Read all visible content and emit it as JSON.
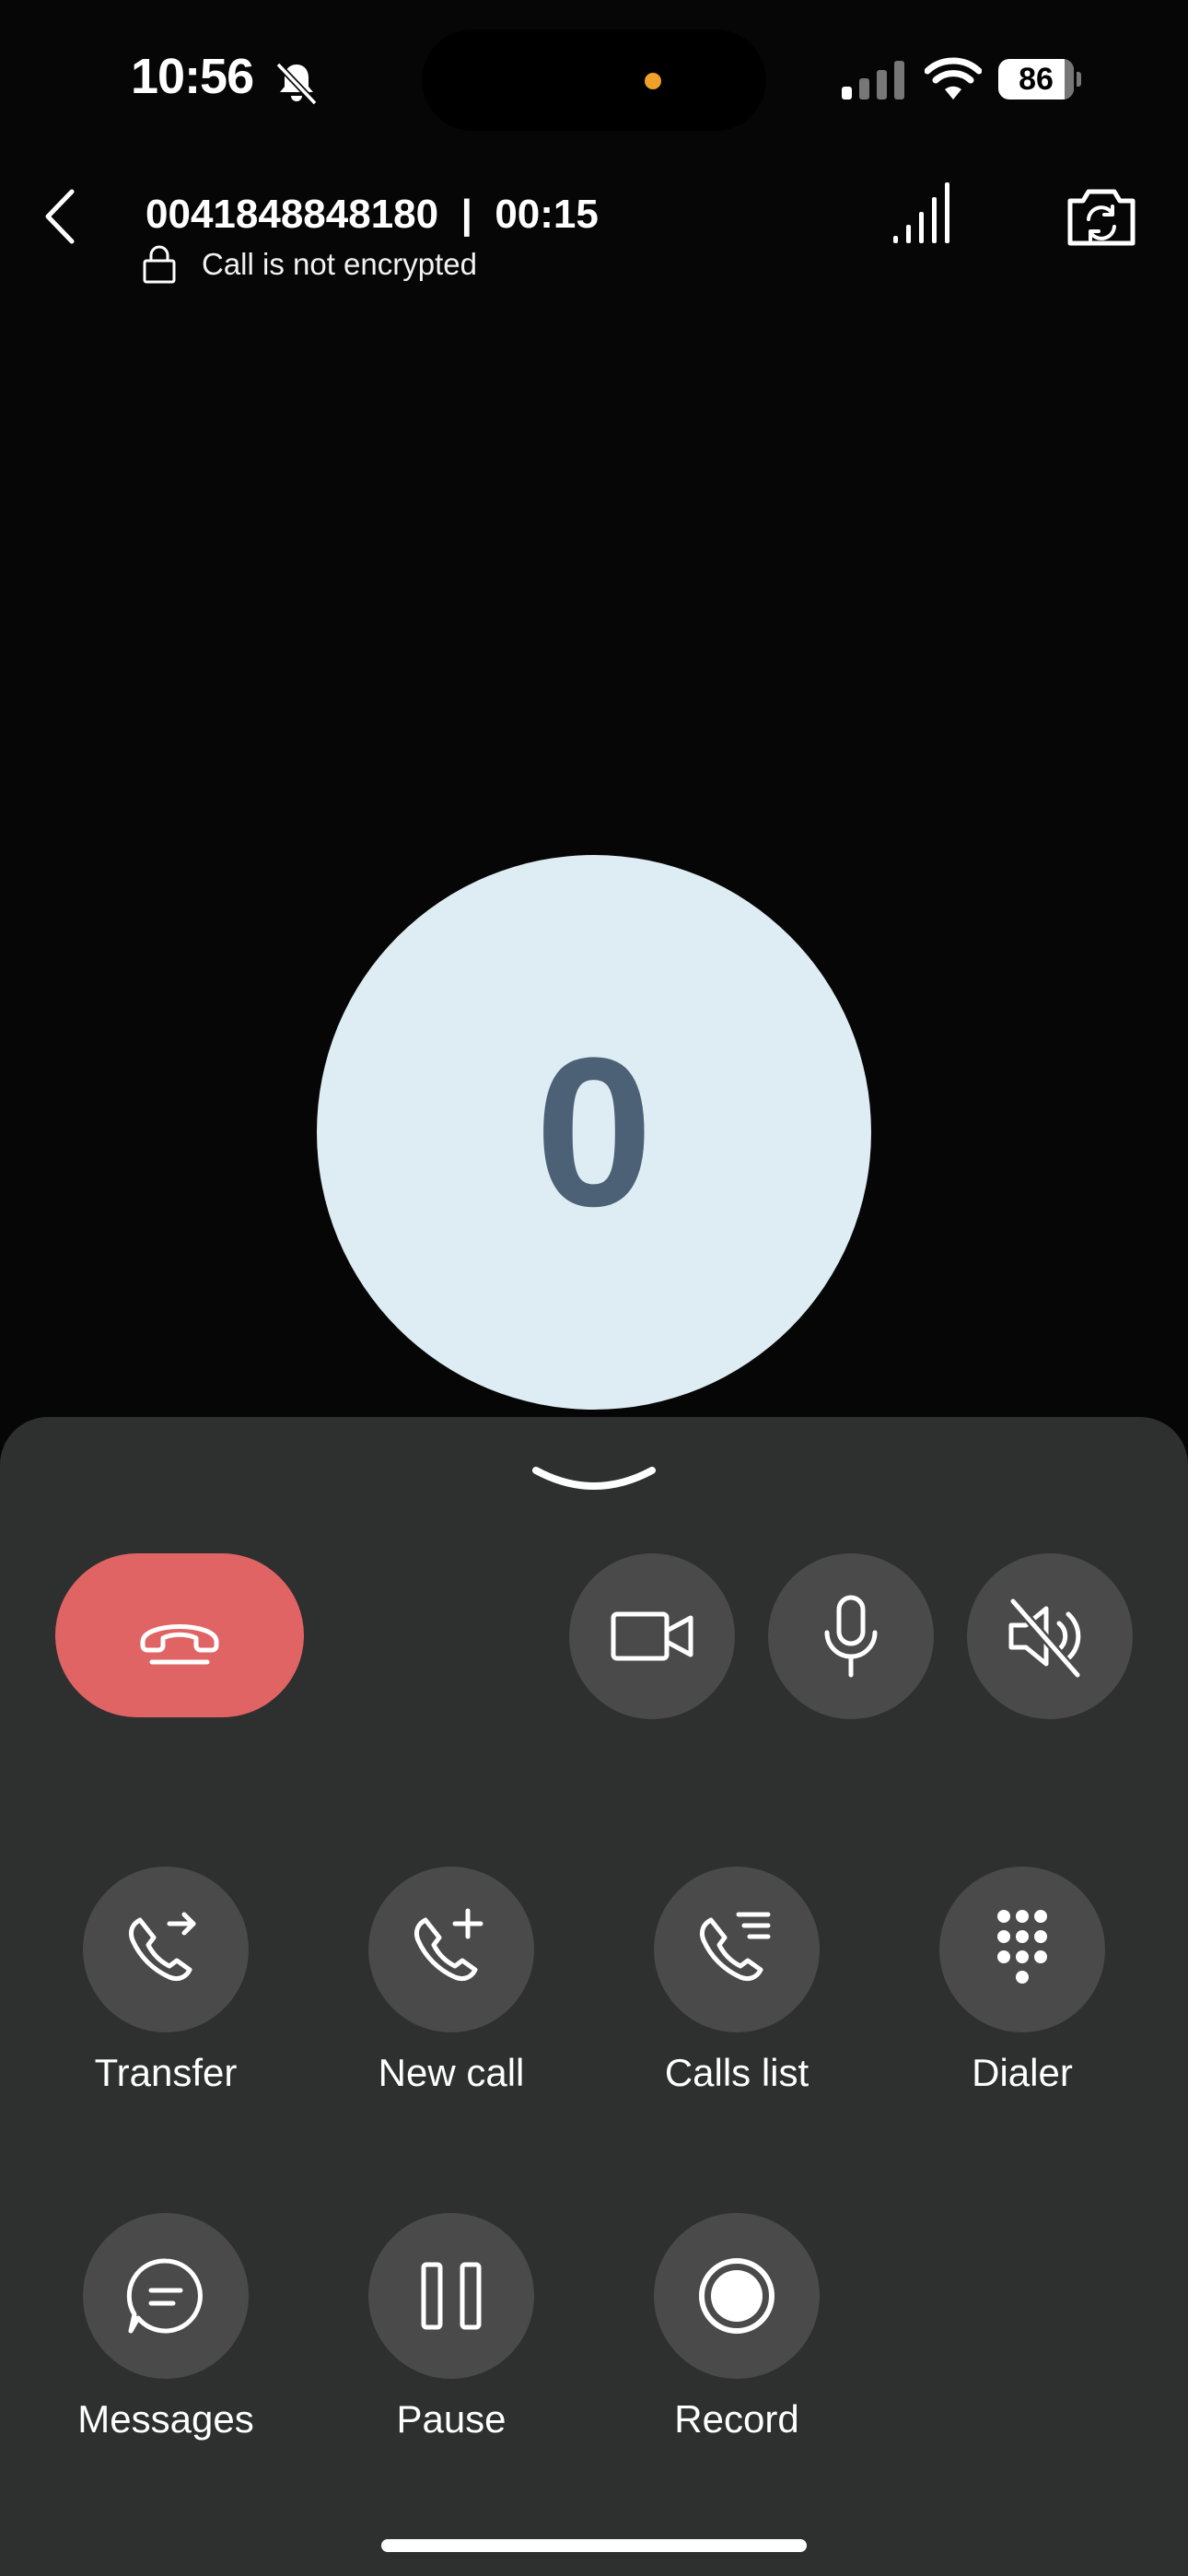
{
  "status_bar": {
    "time": "10:56",
    "battery": "86"
  },
  "call": {
    "title": "0041848848180  |  00:15",
    "encryption_text": "Call is not encrypted",
    "avatar_letter": "0"
  },
  "actions": {
    "transfer": "Transfer",
    "new_call": "New call",
    "calls_list": "Calls list",
    "dialer": "Dialer",
    "messages": "Messages",
    "pause": "Pause",
    "record": "Record"
  },
  "colors": {
    "hangup": "#e06464",
    "sheet": "#2e2f2f",
    "button": "#4a4a4a",
    "avatar_bg": "#deedf3",
    "avatar_text": "#4c6076",
    "island_dot": "#f0a12a"
  },
  "icons": [
    "bell-slash-icon",
    "cellular-icon",
    "wifi-icon",
    "battery-icon",
    "back-chevron-icon",
    "lock-icon",
    "signal-strength-icon",
    "camera-flip-icon",
    "chevron-down-icon",
    "hangup-icon",
    "video-icon",
    "microphone-icon",
    "speaker-mute-icon",
    "transfer-icon",
    "new-call-icon",
    "calls-list-icon",
    "dialer-icon",
    "messages-icon",
    "pause-icon",
    "record-icon"
  ]
}
